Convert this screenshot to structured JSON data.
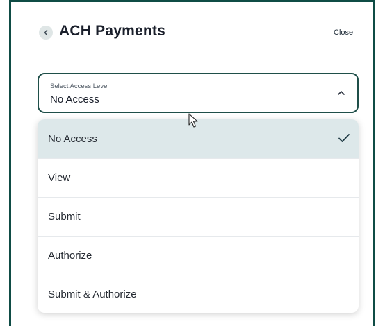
{
  "header": {
    "title": "ACH Payments",
    "close_label": "Close"
  },
  "select": {
    "label": "Select Access Level",
    "value": "No Access"
  },
  "menu": {
    "items": [
      {
        "label": "No Access",
        "selected": true
      },
      {
        "label": "View",
        "selected": false
      },
      {
        "label": "Submit",
        "selected": false
      },
      {
        "label": "Authorize",
        "selected": false
      },
      {
        "label": "Submit & Authorize",
        "selected": false
      }
    ]
  },
  "icons": {
    "back": "chevron-left-icon",
    "dropdown": "chevron-up-icon",
    "selected": "check-icon",
    "pointer": "mouse-cursor-icon"
  },
  "colors": {
    "accent": "#0f4c45",
    "selected_bg": "#dde8ea"
  }
}
